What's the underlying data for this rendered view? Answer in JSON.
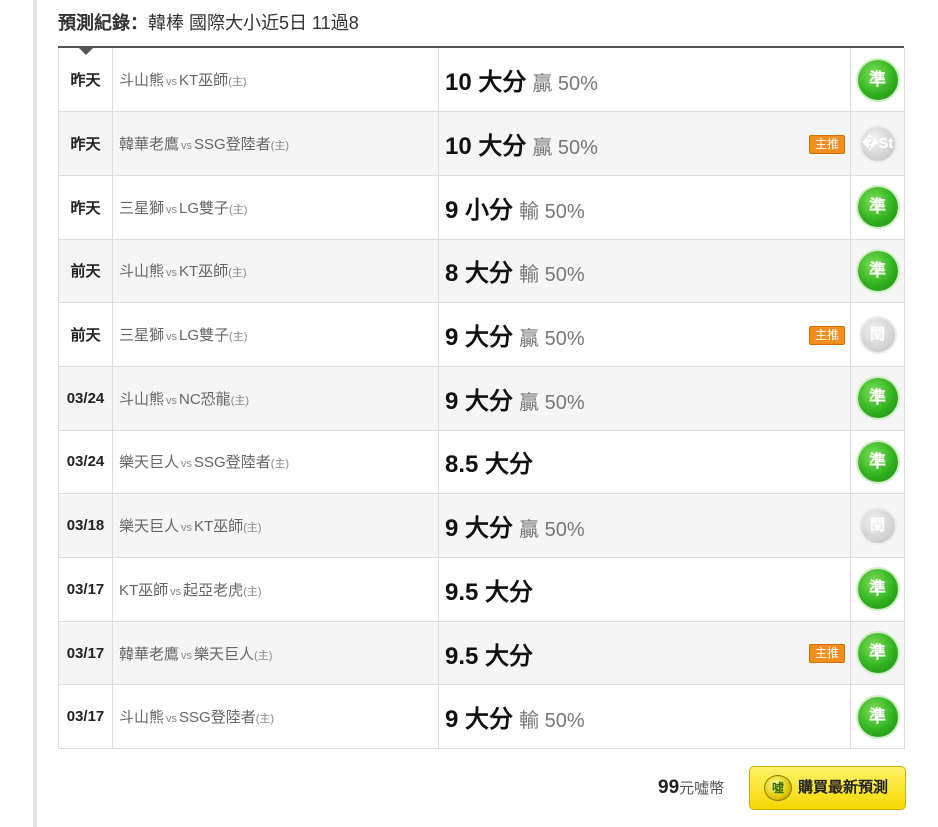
{
  "header": {
    "label": "預測紀錄：",
    "summary": "韓棒 國際大小近5日 11過8"
  },
  "rows": [
    {
      "date": "昨天",
      "away": "斗山熊",
      "vs": "vs",
      "home": "KT巫師",
      "home_tag": "(主)",
      "line": "10 大分",
      "result": "贏 50%",
      "badge": "",
      "status": "準"
    },
    {
      "date": "昨天",
      "away": "韓華老鷹",
      "vs": "vs",
      "home": "SSG登陸者",
      "home_tag": "(主)",
      "line": "10 大分",
      "result": "贏 50%",
      "badge": "主推",
      "status": "�St"
    },
    {
      "date": "昨天",
      "away": "三星獅",
      "vs": "vs",
      "home": "LG雙子",
      "home_tag": "(主)",
      "line": "9 小分",
      "result": "輸 50%",
      "badge": "",
      "status": "準"
    },
    {
      "date": "前天",
      "away": "斗山熊",
      "vs": "vs",
      "home": "KT巫師",
      "home_tag": "(主)",
      "line": "8 大分",
      "result": "輸 50%",
      "badge": "",
      "status": "準"
    },
    {
      "date": "前天",
      "away": "三星獅",
      "vs": "vs",
      "home": "LG雙子",
      "home_tag": "(主)",
      "line": "9 大分",
      "result": "贏 50%",
      "badge": "主推",
      "status": "閏"
    },
    {
      "date": "03/24",
      "away": "斗山熊",
      "vs": "vs",
      "home": "NC恐龍",
      "home_tag": "(主)",
      "line": "9 大分",
      "result": "贏 50%",
      "badge": "",
      "status": "準"
    },
    {
      "date": "03/24",
      "away": "樂天巨人",
      "vs": "vs",
      "home": "SSG登陸者",
      "home_tag": "(主)",
      "line": "8.5 大分",
      "result": "",
      "badge": "",
      "status": "準"
    },
    {
      "date": "03/18",
      "away": "樂天巨人",
      "vs": "vs",
      "home": "KT巫師",
      "home_tag": "(主)",
      "line": "9 大分",
      "result": "贏 50%",
      "badge": "",
      "status": "閏"
    },
    {
      "date": "03/17",
      "away": "KT巫師",
      "vs": "vs",
      "home": "起亞老虎",
      "home_tag": "(主)",
      "line": "9.5 大分",
      "result": "",
      "badge": "",
      "status": "準"
    },
    {
      "date": "03/17",
      "away": "韓華老鷹",
      "vs": "vs",
      "home": "樂天巨人",
      "home_tag": "(主)",
      "line": "9.5 大分",
      "result": "",
      "badge": "主推",
      "status": "準"
    },
    {
      "date": "03/17",
      "away": "斗山熊",
      "vs": "vs",
      "home": "SSG登陸者",
      "home_tag": "(主)",
      "line": "9 大分",
      "result": "輸 50%",
      "badge": "",
      "status": "準"
    }
  ],
  "status_types": {
    "準": "hit",
    "閏": "pending"
  },
  "footer": {
    "price": "99",
    "price_unit": "元噓幣",
    "buy_label": "購買最新預測",
    "coin_icon_text": "噓"
  }
}
